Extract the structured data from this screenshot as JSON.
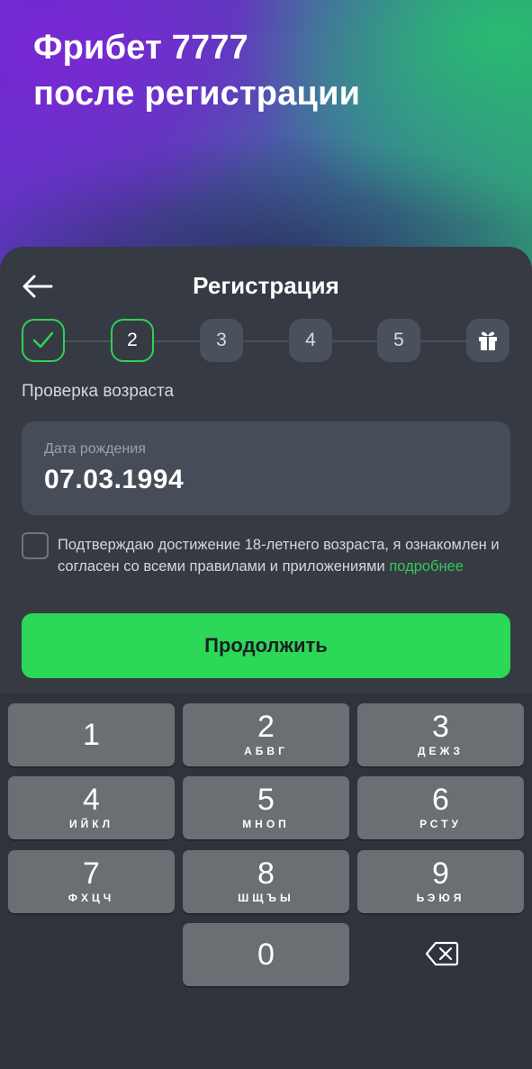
{
  "hero": {
    "line1": "Фрибет 7777",
    "line2": "после регистрации"
  },
  "header": {
    "title": "Регистрация",
    "back_icon": "arrow-left-icon"
  },
  "steps": {
    "items": [
      {
        "label": "",
        "state": "done",
        "icon": "check-icon"
      },
      {
        "label": "2",
        "state": "active"
      },
      {
        "label": "3",
        "state": "pending"
      },
      {
        "label": "4",
        "state": "pending"
      },
      {
        "label": "5",
        "state": "pending"
      },
      {
        "label": "",
        "state": "pending",
        "icon": "gift-icon"
      }
    ],
    "accent_color": "#2fd158"
  },
  "form": {
    "section_title": "Проверка возраста",
    "birthdate_label": "Дата рождения",
    "birthdate_value": "07.03.1994",
    "consent_text": "Подтверждаю достижение 18-летнего возраста, я ознакомлен и согласен со всеми правилами и приложениями",
    "consent_link": "подробнее",
    "consent_checked": false,
    "submit_label": "Продолжить",
    "submit_color": "#2bd857"
  },
  "keypad": {
    "keys": [
      {
        "num": "1",
        "letters": ""
      },
      {
        "num": "2",
        "letters": "АБВГ"
      },
      {
        "num": "3",
        "letters": "ДЕЖЗ"
      },
      {
        "num": "4",
        "letters": "ИЙКЛ"
      },
      {
        "num": "5",
        "letters": "МНОП"
      },
      {
        "num": "6",
        "letters": "РСТУ"
      },
      {
        "num": "7",
        "letters": "ФХЦЧ"
      },
      {
        "num": "8",
        "letters": "ШЩЪЫ"
      },
      {
        "num": "9",
        "letters": "ЬЭЮЯ"
      },
      {
        "num": "0",
        "letters": ""
      }
    ],
    "backspace_icon": "backspace-icon"
  }
}
